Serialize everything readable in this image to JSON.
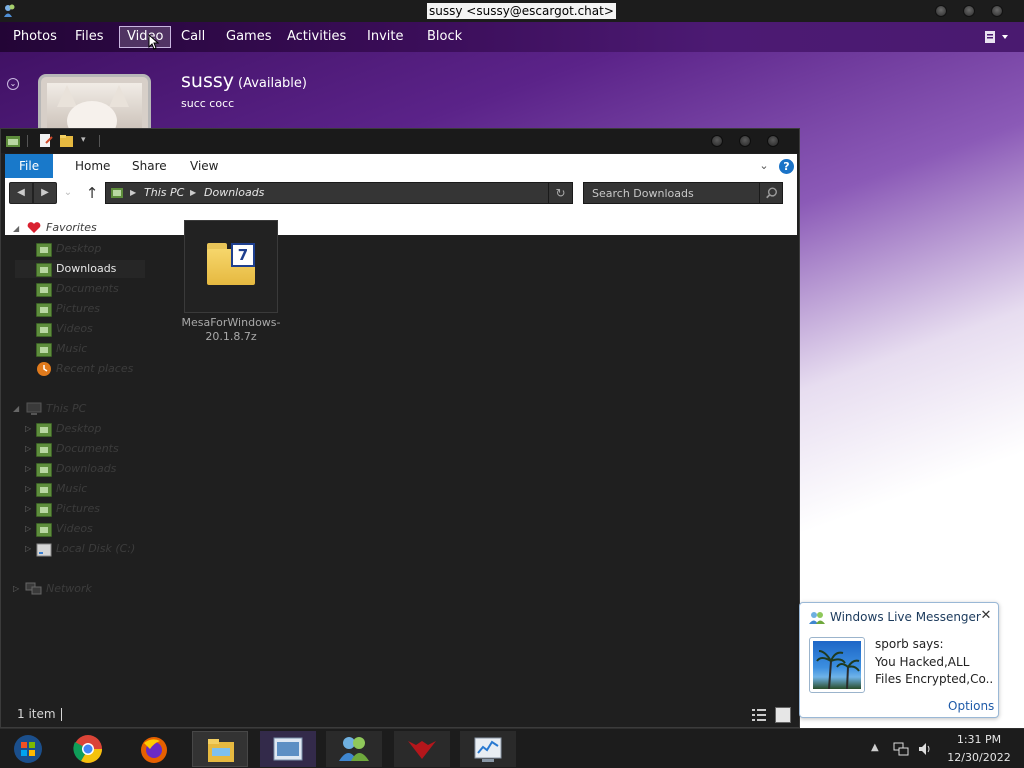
{
  "messenger": {
    "window_title": "sussy <sussy@escargot.chat>",
    "menu": [
      "Photos",
      "Files",
      "Video",
      "Call",
      "Games",
      "Activities",
      "Invite",
      "Block"
    ],
    "contact_name": "sussy",
    "contact_status": "(Available)",
    "personal_message": "succ cocc"
  },
  "explorer": {
    "ribbon_tabs": [
      "File",
      "Home",
      "Share",
      "View"
    ],
    "breadcrumb": [
      "This PC",
      "Downloads"
    ],
    "search_placeholder": "Search Downloads",
    "nav_pane": {
      "favorites": "Favorites",
      "favorites_items": [
        "Desktop",
        "Downloads",
        "Documents",
        "Pictures",
        "Videos",
        "Music",
        "Recent places"
      ],
      "this_pc": "This PC",
      "this_pc_items": [
        "Desktop",
        "Documents",
        "Downloads",
        "Music",
        "Pictures",
        "Videos",
        "Local Disk (C:)"
      ],
      "network": "Network"
    },
    "file": {
      "name": "MesaForWindows-20.1.8.7z",
      "badge": "7"
    },
    "status_text": "1 item"
  },
  "toast": {
    "title": "Windows Live Messenger",
    "sender": "sporb says:",
    "message_lines": [
      "You Hacked,ALL",
      "Files Encrypted,Co..."
    ],
    "options_label": "Options"
  },
  "taskbar": {
    "time": "1:31 PM",
    "date": "12/30/2022"
  },
  "colors": {
    "messenger_purple": "#3a0d58",
    "ribbon_file_blue": "#1979ca",
    "explorer_dark": "#1f1f1f",
    "toast_border": "#9ab8d6",
    "link_blue": "#1e5aa8"
  }
}
